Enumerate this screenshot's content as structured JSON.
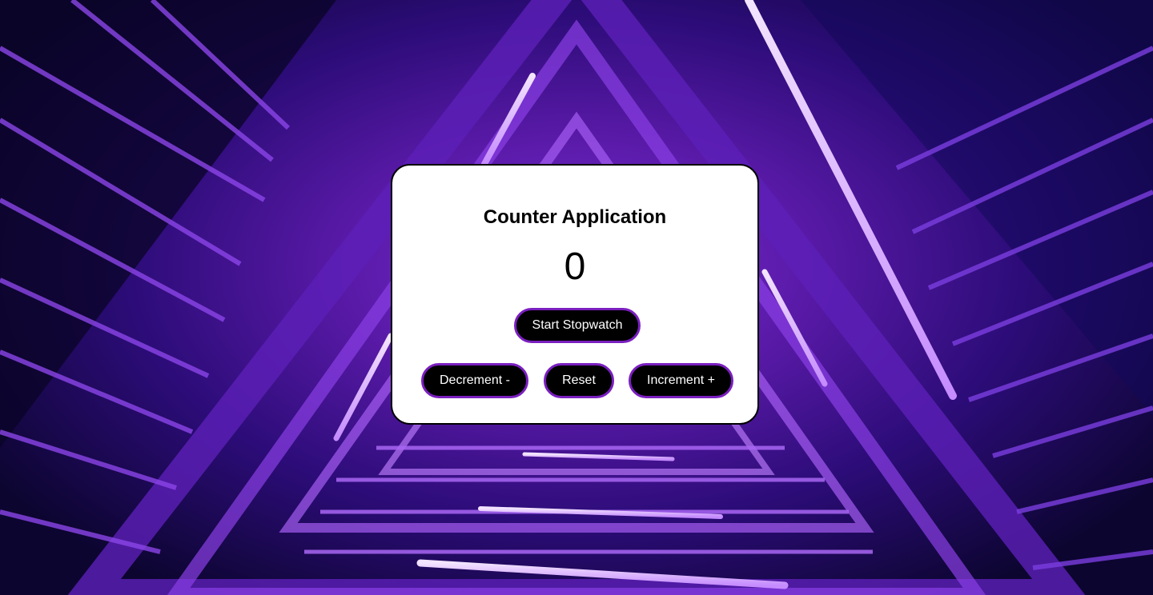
{
  "app": {
    "title": "Counter Application",
    "count": "0"
  },
  "controls": {
    "stopwatch_label": "Start Stopwatch",
    "decrement_label": "Decrement -",
    "reset_label": "Reset",
    "increment_label": "Increment +"
  },
  "colors": {
    "button_background": "#000000",
    "button_border": "#7b1fc0",
    "card_background": "#ffffff",
    "page_background": "#3a0f8f"
  },
  "background": {
    "description_icon": "neon-stairwell-image"
  }
}
